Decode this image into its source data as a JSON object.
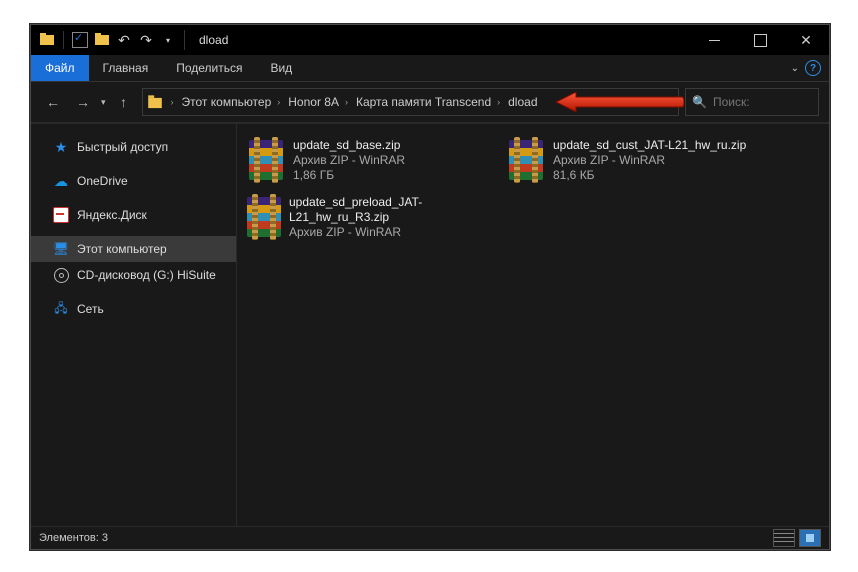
{
  "titlebar": {
    "title": "dload"
  },
  "ribbon": {
    "file": "Файл",
    "home": "Главная",
    "share": "Поделиться",
    "view": "Вид"
  },
  "nav": {
    "back": "←",
    "forward": "→",
    "up": "↑"
  },
  "breadcrumb": {
    "items": [
      {
        "label": "Этот компьютер"
      },
      {
        "label": "Honor 8A"
      },
      {
        "label": "Карта памяти Transcend"
      },
      {
        "label": "dload"
      }
    ]
  },
  "search": {
    "placeholder": "Поиск:"
  },
  "navpane": {
    "quick_access": "Быстрый доступ",
    "onedrive": "OneDrive",
    "yandex_disk": "Яндекс.Диск",
    "this_pc": "Этот компьютер",
    "cd_drive": "CD-дисковод (G:) HiSuite",
    "network": "Сеть"
  },
  "files": [
    {
      "name": "update_sd_base.zip",
      "type": "Архив ZIP - WinRAR",
      "size": "1,86 ГБ"
    },
    {
      "name": "update_sd_cust_JAT-L21_hw_ru.zip",
      "type": "Архив ZIP - WinRAR",
      "size": "81,6 КБ"
    },
    {
      "name": "update_sd_preload_JAT-L21_hw_ru_R3.zip",
      "type": "Архив ZIP - WinRAR",
      "size": ""
    }
  ],
  "statusbar": {
    "items_label": "Элементов: 3"
  }
}
